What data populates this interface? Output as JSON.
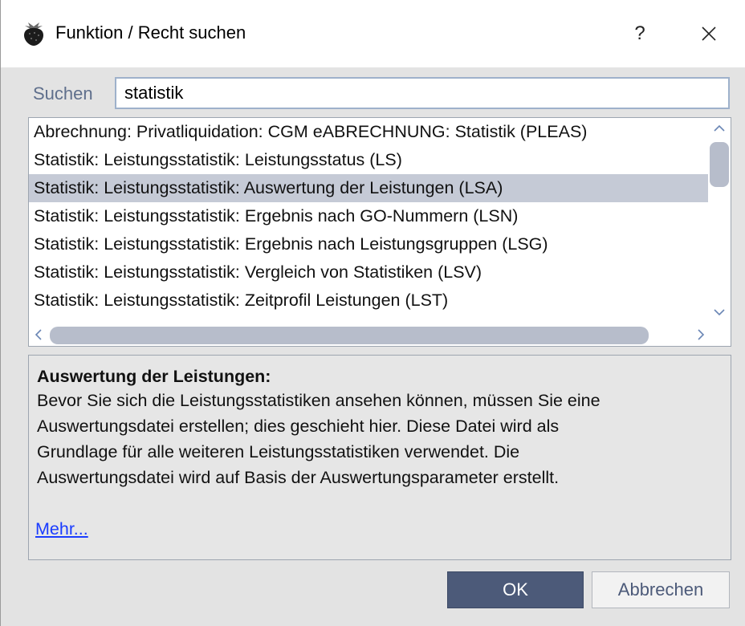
{
  "window": {
    "title": "Funktion / Recht suchen",
    "help_label": "?",
    "icons": {
      "app": "strawberry-icon",
      "close": "close-icon"
    }
  },
  "search": {
    "label": "Suchen",
    "value": "statistik"
  },
  "results": {
    "selected_index": 2,
    "items": [
      "Abrechnung: Privatliquidation: CGM eABRECHNUNG: Statistik (PLEAS)",
      "Statistik: Leistungsstatistik: Leistungsstatus (LS)",
      "Statistik: Leistungsstatistik: Auswertung der Leistungen (LSA)",
      "Statistik: Leistungsstatistik: Ergebnis nach GO-Nummern (LSN)",
      "Statistik: Leistungsstatistik: Ergebnis nach Leistungsgruppen (LSG)",
      "Statistik: Leistungsstatistik: Vergleich von Statistiken (LSV)",
      "Statistik: Leistungsstatistik: Zeitprofil Leistungen (LST)"
    ]
  },
  "description": {
    "heading": "Auswertung der Leistungen:",
    "lines": [
      "Bevor Sie sich die Leistungsstatistiken ansehen können, müssen Sie eine",
      " Auswertungsdatei erstellen; dies geschieht hier. Diese Datei wird als",
      " Grundlage für alle weiteren Leistungsstatistiken verwendet. Die",
      " Auswertungsdatei wird auf Basis der Auswertungsparameter erstellt."
    ],
    "more_link": "Mehr..."
  },
  "buttons": {
    "ok": "OK",
    "cancel": "Abbrechen"
  },
  "colors": {
    "selection": "#c5cad6",
    "primary_button": "#4c5a79",
    "link": "#1a3cff",
    "input_border": "#9eb1cb"
  }
}
